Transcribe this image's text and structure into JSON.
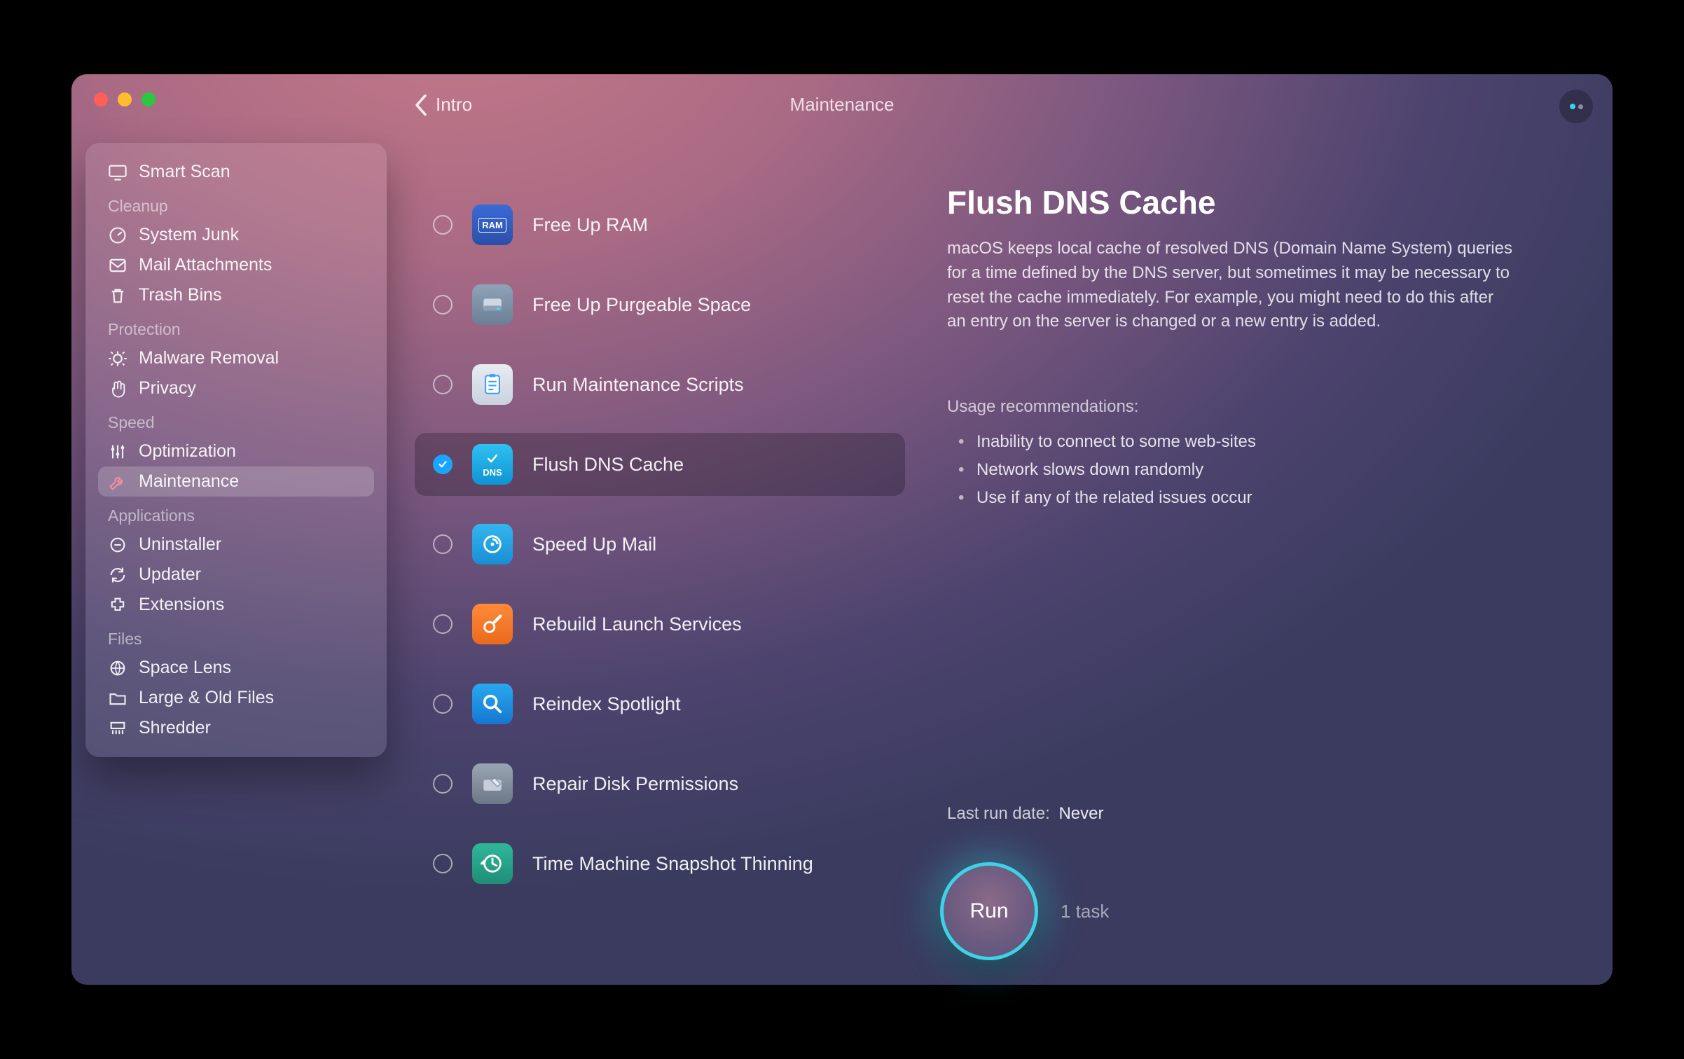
{
  "header": {
    "back_label": "Intro",
    "title": "Maintenance"
  },
  "sidebar": {
    "top": {
      "label": "Smart Scan"
    },
    "sections": [
      {
        "title": "Cleanup",
        "items": [
          {
            "label": "System Junk"
          },
          {
            "label": "Mail Attachments"
          },
          {
            "label": "Trash Bins"
          }
        ]
      },
      {
        "title": "Protection",
        "items": [
          {
            "label": "Malware Removal"
          },
          {
            "label": "Privacy"
          }
        ]
      },
      {
        "title": "Speed",
        "items": [
          {
            "label": "Optimization"
          },
          {
            "label": "Maintenance"
          }
        ]
      },
      {
        "title": "Applications",
        "items": [
          {
            "label": "Uninstaller"
          },
          {
            "label": "Updater"
          },
          {
            "label": "Extensions"
          }
        ]
      },
      {
        "title": "Files",
        "items": [
          {
            "label": "Space Lens"
          },
          {
            "label": "Large & Old Files"
          },
          {
            "label": "Shredder"
          }
        ]
      }
    ]
  },
  "tasks": [
    {
      "label": "Free Up RAM"
    },
    {
      "label": "Free Up Purgeable Space"
    },
    {
      "label": "Run Maintenance Scripts"
    },
    {
      "label": "Flush DNS Cache"
    },
    {
      "label": "Speed Up Mail"
    },
    {
      "label": "Rebuild Launch Services"
    },
    {
      "label": "Reindex Spotlight"
    },
    {
      "label": "Repair Disk Permissions"
    },
    {
      "label": "Time Machine Snapshot Thinning"
    }
  ],
  "detail": {
    "title": "Flush DNS Cache",
    "description": "macOS keeps local cache of resolved DNS (Domain Name System) queries for a time defined by the DNS server, but sometimes it may be necessary to reset the cache immediately. For example, you might need to do this after an entry on the server is changed or a new entry is added.",
    "usage_title": "Usage recommendations:",
    "usage": [
      "Inability to connect to some web-sites",
      "Network slows down randomly",
      "Use if any of the related issues occur"
    ],
    "last_run_label": "Last run date:",
    "last_run_value": "Never"
  },
  "run": {
    "label": "Run",
    "count": "1 task"
  },
  "icon_labels": {
    "ram": "RAM",
    "dns": "DNS"
  }
}
